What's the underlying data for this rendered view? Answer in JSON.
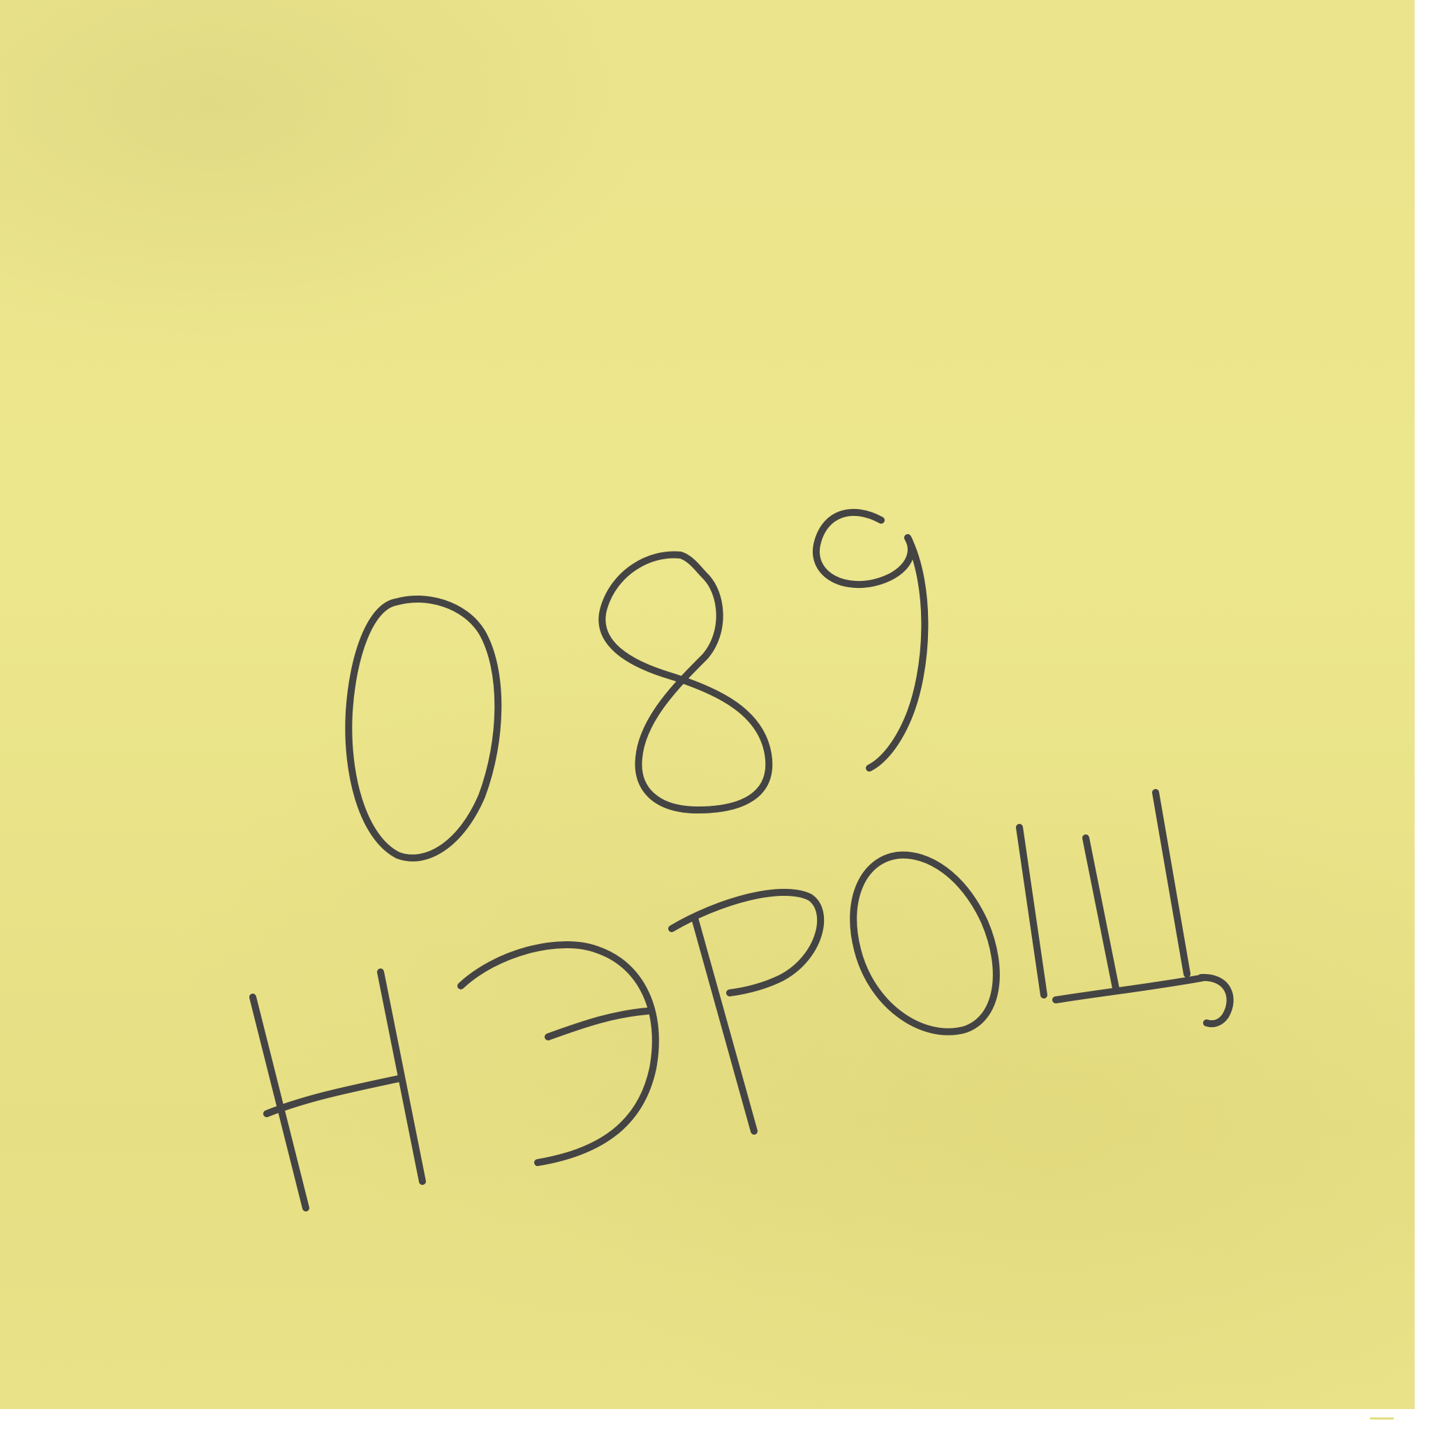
{
  "note": {
    "line1": "089",
    "line2": "НЭРОЩ"
  },
  "colors": {
    "paper": "#ebe48c",
    "ink": "#444444",
    "background": "#ffffff"
  }
}
